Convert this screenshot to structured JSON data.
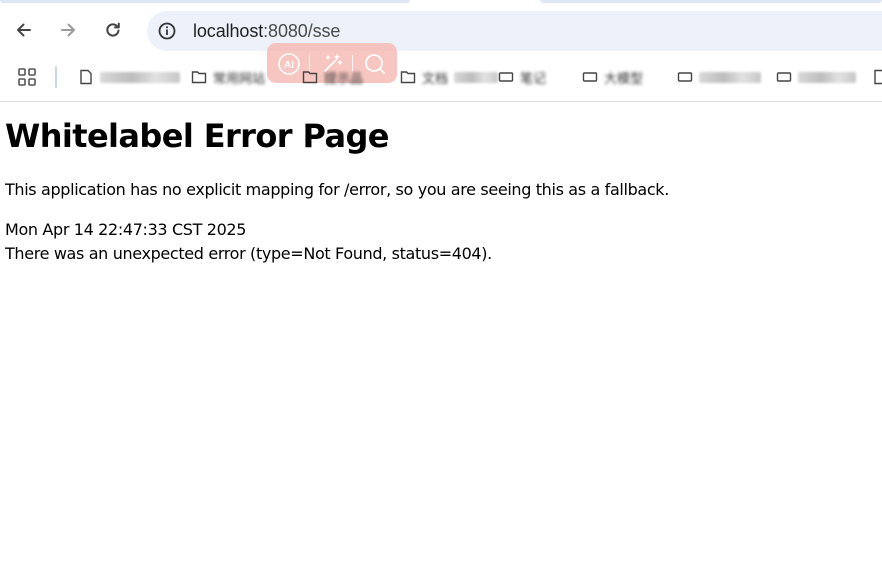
{
  "browser": {
    "address_bar": {
      "url_host": "localhost",
      "url_rest": ":8080/sse"
    },
    "nav": {
      "back_icon": "arrow-left-icon",
      "forward_icon": "arrow-right-icon",
      "reload_icon": "reload-icon",
      "info_icon": "info-circle-icon"
    },
    "extension_toolbar": {
      "tools": [
        "ai-icon",
        "magic-wand-icon",
        "search-icon"
      ]
    },
    "bookmarks_bar": {
      "apps_icon": "apps-grid-icon",
      "items": [
        {
          "icon": "page-icon",
          "label": ""
        },
        {
          "icon": "folder-icon",
          "label": "常用网站"
        },
        {
          "icon": "folder-icon",
          "label": "提示品"
        },
        {
          "icon": "folder-icon",
          "label": "文档"
        },
        {
          "icon": "page-icon",
          "label": "笔记"
        },
        {
          "icon": "page-icon",
          "label": "大模型"
        },
        {
          "icon": "page-icon",
          "label": ""
        },
        {
          "icon": "page-icon",
          "label": ""
        },
        {
          "icon": "page-icon",
          "label": ""
        }
      ]
    }
  },
  "page": {
    "title": "Whitelabel Error Page",
    "message": "This application has no explicit mapping for /error, so you are seeing this as a fallback.",
    "timestamp": "Mon Apr 14 22:47:33 CST 2025",
    "error": "There was an unexpected error (type=Not Found, status=404)."
  }
}
